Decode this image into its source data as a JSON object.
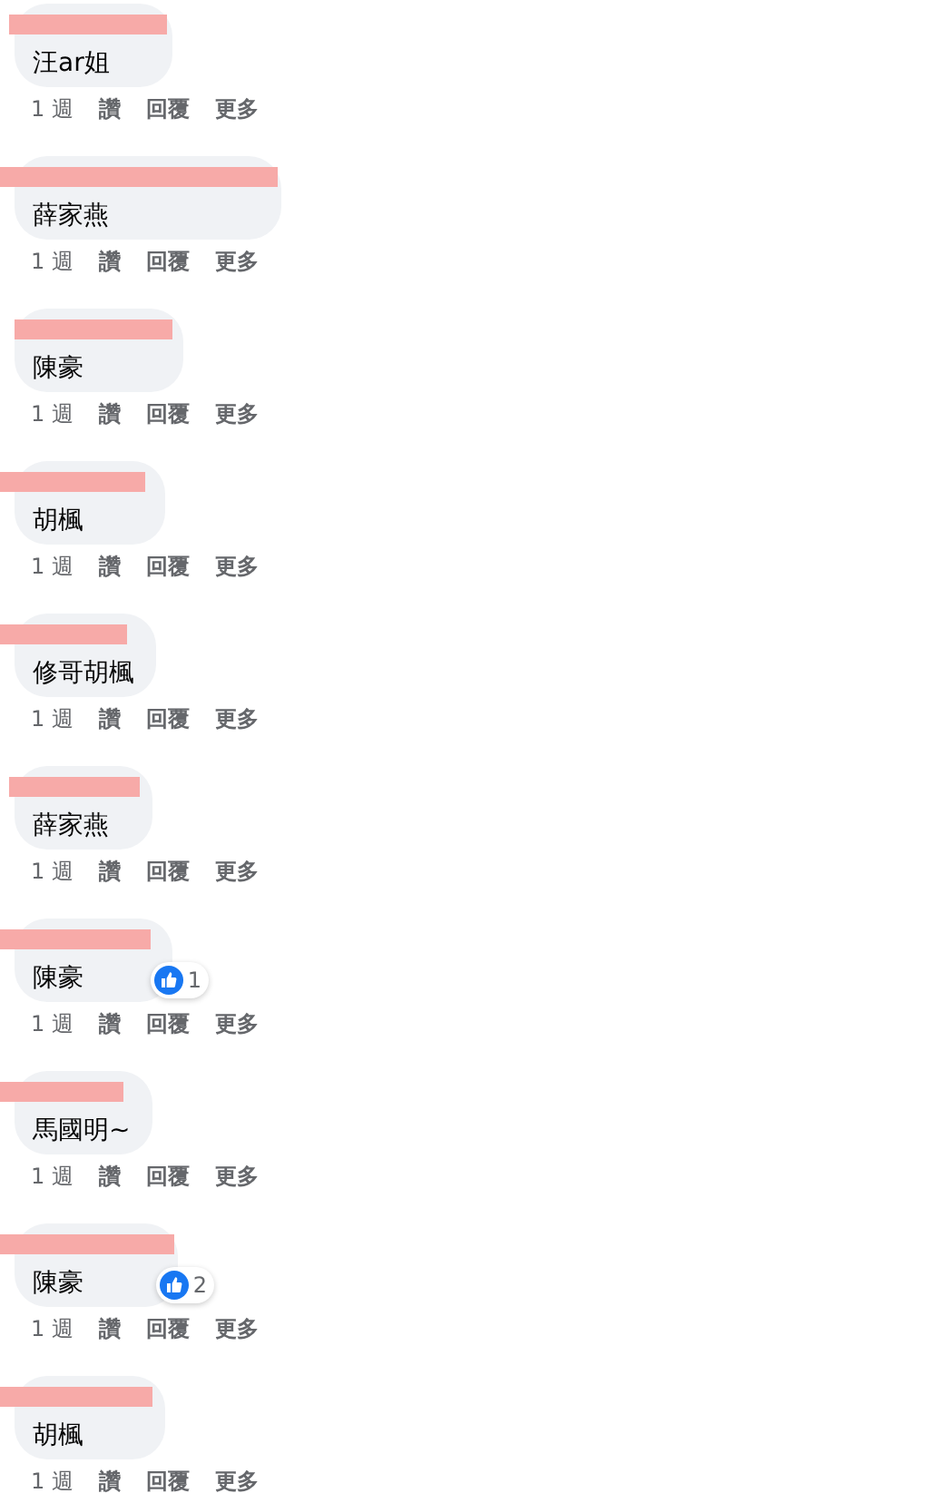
{
  "comments": [
    {
      "text": "汪ar姐",
      "time": "1 週",
      "actions": [
        "讚",
        "回覆",
        "更多"
      ]
    },
    {
      "text": "薛家燕",
      "time": "1 週",
      "actions": [
        "讚",
        "回覆",
        "更多"
      ]
    },
    {
      "text": "陳豪",
      "time": "1 週",
      "actions": [
        "讚",
        "回覆",
        "更多"
      ]
    },
    {
      "text": "胡楓",
      "time": "1 週",
      "actions": [
        "讚",
        "回覆",
        "更多"
      ]
    },
    {
      "text": "修哥胡楓",
      "time": "1 週",
      "actions": [
        "讚",
        "回覆",
        "更多"
      ]
    },
    {
      "text": "薛家燕",
      "time": "1 週",
      "actions": [
        "讚",
        "回覆",
        "更多"
      ]
    },
    {
      "text": "陳豪",
      "time": "1 週",
      "actions": [
        "讚",
        "回覆",
        "更多"
      ],
      "likes": "1"
    },
    {
      "text": "馬國明~",
      "time": "1 週",
      "actions": [
        "讚",
        "回覆",
        "更多"
      ]
    },
    {
      "text": "陳豪",
      "time": "1 週",
      "actions": [
        "讚",
        "回覆",
        "更多"
      ],
      "likes": "2"
    },
    {
      "text": "胡楓",
      "time": "1 週",
      "actions": [
        "讚",
        "回覆",
        "更多"
      ]
    }
  ]
}
